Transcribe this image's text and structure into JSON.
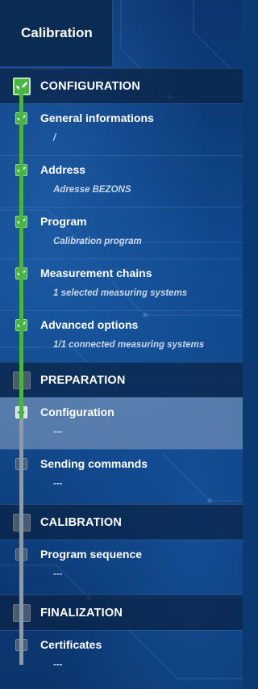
{
  "header": {
    "title": "Calibration"
  },
  "sections": [
    {
      "label": "CONFIGURATION",
      "state": "done",
      "items": [
        {
          "name": "General informations",
          "detail": "/",
          "state": "done"
        },
        {
          "name": "Address",
          "detail": "Adresse BEZONS",
          "state": "done"
        },
        {
          "name": "Program",
          "detail": "Calibration program",
          "state": "done"
        },
        {
          "name": "Measurement chains",
          "detail": "1 selected measuring systems",
          "state": "done"
        },
        {
          "name": "Advanced options",
          "detail": "1/1 connected measuring systems",
          "state": "done"
        }
      ]
    },
    {
      "label": "PREPARATION",
      "state": "todo",
      "items": [
        {
          "name": "Configuration",
          "detail": "---",
          "state": "current"
        },
        {
          "name": "Sending commands",
          "detail": "---",
          "state": "todo"
        }
      ]
    },
    {
      "label": "CALIBRATION",
      "state": "todo",
      "items": [
        {
          "name": "Program sequence",
          "detail": "---",
          "state": "todo"
        }
      ]
    },
    {
      "label": "FINALIZATION",
      "state": "todo",
      "items": [
        {
          "name": "Certificates",
          "detail": "---",
          "state": "todo"
        }
      ]
    }
  ],
  "colors": {
    "done": "#4ab342",
    "todo": "#4b5b6e",
    "active_row": "#8ca5c3"
  },
  "icons": {
    "done": "check-icon",
    "current": "arrow-right-icon"
  }
}
